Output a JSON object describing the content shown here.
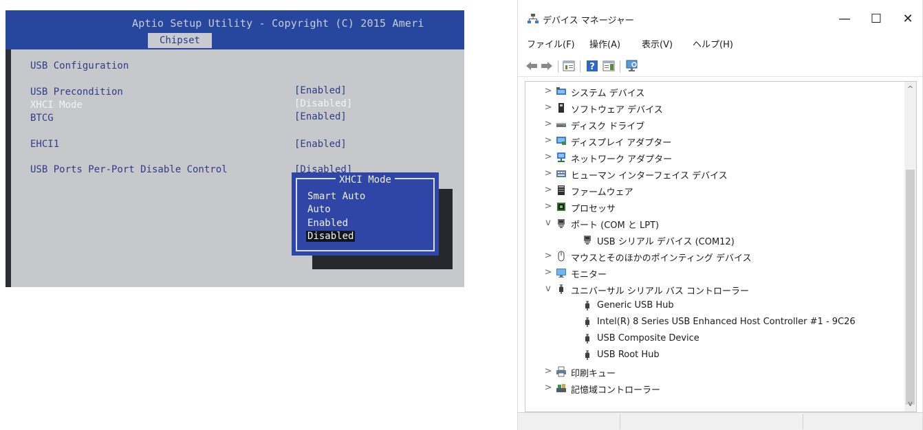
{
  "bios": {
    "title": "Aptio Setup Utility - Copyright (C) 2015 Ameri",
    "active_tab": "Chipset",
    "section_title": "USB Configuration",
    "settings": [
      {
        "label": "USB Precondition",
        "value": "[Enabled]"
      },
      {
        "label": "XHCI Mode",
        "value": "[Disabled]"
      },
      {
        "label": "BTCG",
        "value": "[Enabled]"
      },
      {
        "label": "EHCI1",
        "value": "[Enabled]"
      },
      {
        "label": "USB Ports Per-Port Disable Control",
        "value": "[Disabled]"
      }
    ],
    "popup": {
      "title": "XHCI Mode",
      "options": [
        "Smart Auto",
        "Auto",
        "Enabled",
        "Disabled"
      ],
      "selected": "Disabled"
    },
    "colors": {
      "header": "#27479e",
      "panel": "#c6c8cc",
      "popup": "#2f46a7",
      "text": "#2f3c86"
    }
  },
  "device_manager": {
    "window_title": "デバイス マネージャー",
    "window_buttons": {
      "minimize": "—",
      "maximize": "☐",
      "close": "✕"
    },
    "menu": [
      "ファイル(F)",
      "操作(A)",
      "表示(V)",
      "ヘルプ(H)"
    ],
    "toolbar_icons": [
      "back-arrow-icon",
      "forward-arrow-icon",
      "properties-icon",
      "help-icon",
      "view-icon",
      "monitor-scan-icon"
    ],
    "tree": [
      {
        "label": "システム デバイス",
        "expand": ">",
        "level": 0,
        "icon": "system-device-icon"
      },
      {
        "label": "ソフトウェア デバイス",
        "expand": ">",
        "level": 0,
        "icon": "software-device-icon"
      },
      {
        "label": "ディスク ドライブ",
        "expand": ">",
        "level": 0,
        "icon": "disk-drive-icon"
      },
      {
        "label": "ディスプレイ アダプター",
        "expand": ">",
        "level": 0,
        "icon": "display-adapter-icon"
      },
      {
        "label": "ネットワーク アダプター",
        "expand": ">",
        "level": 0,
        "icon": "network-adapter-icon"
      },
      {
        "label": "ヒューマン インターフェイス デバイス",
        "expand": ">",
        "level": 0,
        "icon": "hid-icon"
      },
      {
        "label": "ファームウェア",
        "expand": ">",
        "level": 0,
        "icon": "firmware-icon"
      },
      {
        "label": "プロセッサ",
        "expand": ">",
        "level": 0,
        "icon": "processor-icon"
      },
      {
        "label": "ポート (COM と LPT)",
        "expand": "v",
        "level": 0,
        "icon": "port-icon"
      },
      {
        "label": "USB シリアル デバイス (COM12)",
        "expand": "",
        "level": 1,
        "icon": "port-icon"
      },
      {
        "label": "マウスとそのほかのポインティング デバイス",
        "expand": ">",
        "level": 0,
        "icon": "mouse-icon"
      },
      {
        "label": "モニター",
        "expand": ">",
        "level": 0,
        "icon": "monitor-icon"
      },
      {
        "label": "ユニバーサル シリアル バス コントローラー",
        "expand": "v",
        "level": 0,
        "icon": "usb-icon"
      },
      {
        "label": "Generic USB Hub",
        "expand": "",
        "level": 1,
        "icon": "usb-icon"
      },
      {
        "label": "Intel(R) 8 Series USB Enhanced Host Controller #1 - 9C26",
        "expand": "",
        "level": 1,
        "icon": "usb-icon"
      },
      {
        "label": "USB Composite Device",
        "expand": "",
        "level": 1,
        "icon": "usb-icon"
      },
      {
        "label": "USB Root Hub",
        "expand": "",
        "level": 1,
        "icon": "usb-icon"
      },
      {
        "label": "印刷キュー",
        "expand": ">",
        "level": 0,
        "icon": "print-queue-icon"
      },
      {
        "label": "記憶域コントローラー",
        "expand": ">",
        "level": 0,
        "icon": "storage-controller-icon"
      }
    ],
    "scrollbar": {
      "up": "^",
      "down": "v"
    }
  }
}
